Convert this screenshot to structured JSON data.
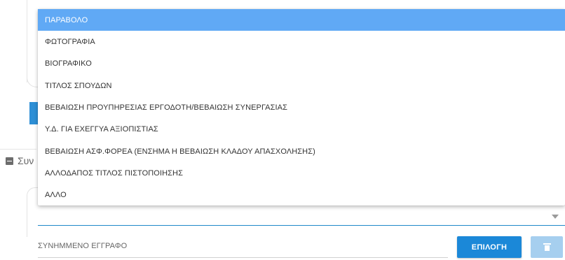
{
  "dropdown": {
    "options": [
      {
        "label": "ΠΑΡΑΒΟΛΟ",
        "selected": true
      },
      {
        "label": "ΦΩΤΟΓΡΑΦΙΑ"
      },
      {
        "label": "ΒΙΟΓΡΑΦΙΚΟ"
      },
      {
        "label": "ΤΙΤΛΟΣ ΣΠΟΥΔΩΝ"
      },
      {
        "label": "ΒΕΒΑΙΩΣΗ ΠΡΟΥΠΗΡΕΣΙΑΣ ΕΡΓΟΔΟΤΗ/ΒΕΒΑΙΩΣΗ ΣΥΝΕΡΓΑΣΙΑΣ"
      },
      {
        "label": "Υ.Δ. ΓΙΑ ΕΧΕΓΓΥΑ ΑΞΙΟΠΙΣΤΙΑΣ"
      },
      {
        "label": "ΒΕΒΑΙΩΣΗ ΑΣΦ.ΦΟΡΕΑ (ΕΝΣΗΜΑ Η ΒΕΒΑΙΩΣΗ ΚΛΑΔΟΥ ΑΠΑΣΧΟΛΗΣΗΣ)"
      },
      {
        "label": "ΑΛΛΟΔΑΠΟΣ ΤΙΤΛΟΣ ΠΙΣΤΟΠΟΙΗΣΗΣ"
      },
      {
        "label": "ΑΛΛΟ"
      }
    ]
  },
  "section": {
    "title": "Συν"
  },
  "attachment": {
    "label": "ΣΥΝΗΜΜΕΝΟ ΕΓΓΡΑΦΟ",
    "select_button": "ΕΠΙΛΟΓΗ"
  },
  "icons": {
    "section_toggle": "minus-square-icon",
    "delete": "trash-icon",
    "select_caret": "caret-down-icon"
  },
  "colors": {
    "primary": "#1b88d8",
    "selected_option": "#60a9f5",
    "disabled_button": "#a6cfef",
    "underline_active": "#1e88c9"
  }
}
